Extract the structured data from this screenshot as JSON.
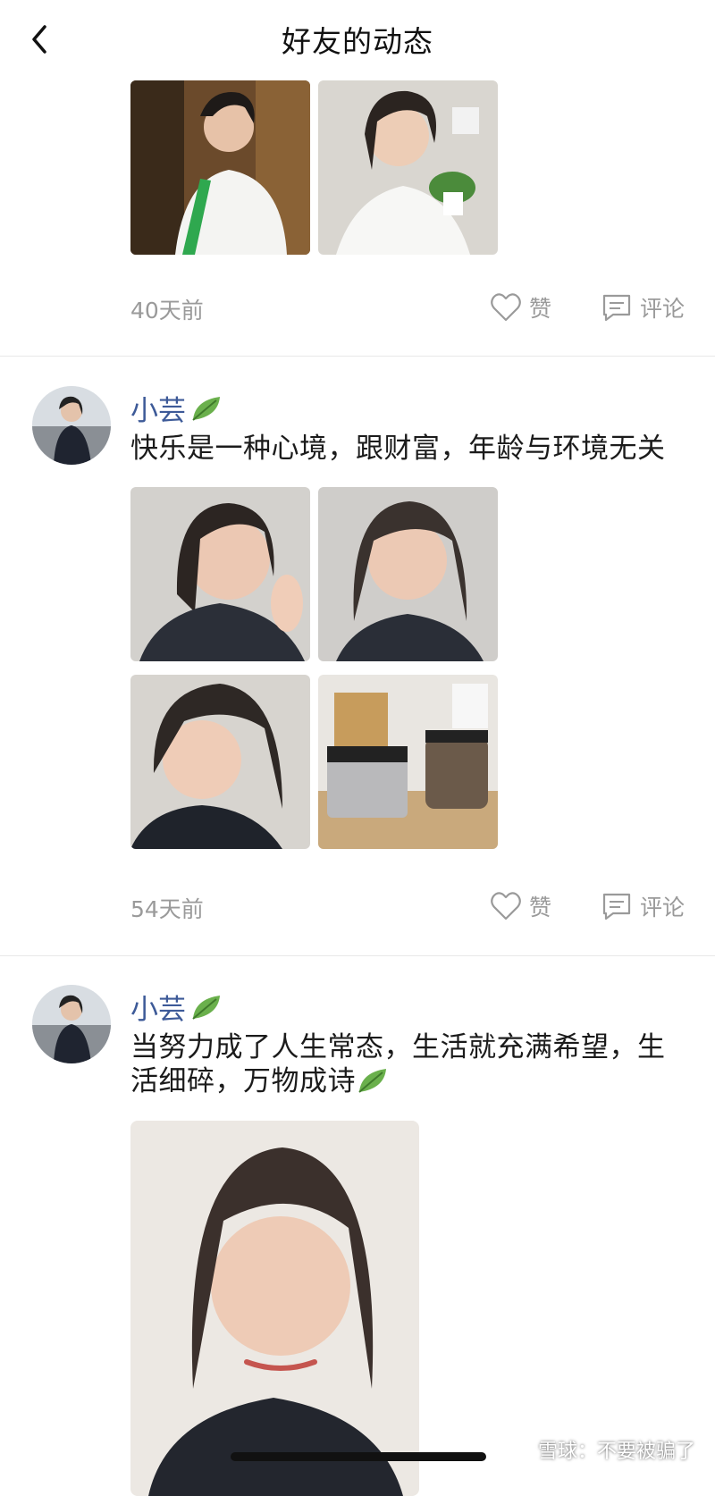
{
  "header": {
    "title": "好友的动态",
    "back_icon": "chevron-left-icon"
  },
  "posts": [
    {
      "time": "40天前",
      "like_label": "赞",
      "comment_label": "评论"
    },
    {
      "author": "小芸",
      "text": "快乐是一种心境，跟财富，年龄与环境无关",
      "time": "54天前",
      "like_label": "赞",
      "comment_label": "评论"
    },
    {
      "author": "小芸",
      "text": "当努力成了人生常态，生活就充满希望，生活细碎，万物成诗"
    }
  ],
  "watermark": "雪球：不要被骗了",
  "colors": {
    "username": "#3d5a98",
    "meta_gray": "#9a9a9a",
    "divider": "#e8e8e8",
    "leaf_green": "#6ab04c"
  }
}
